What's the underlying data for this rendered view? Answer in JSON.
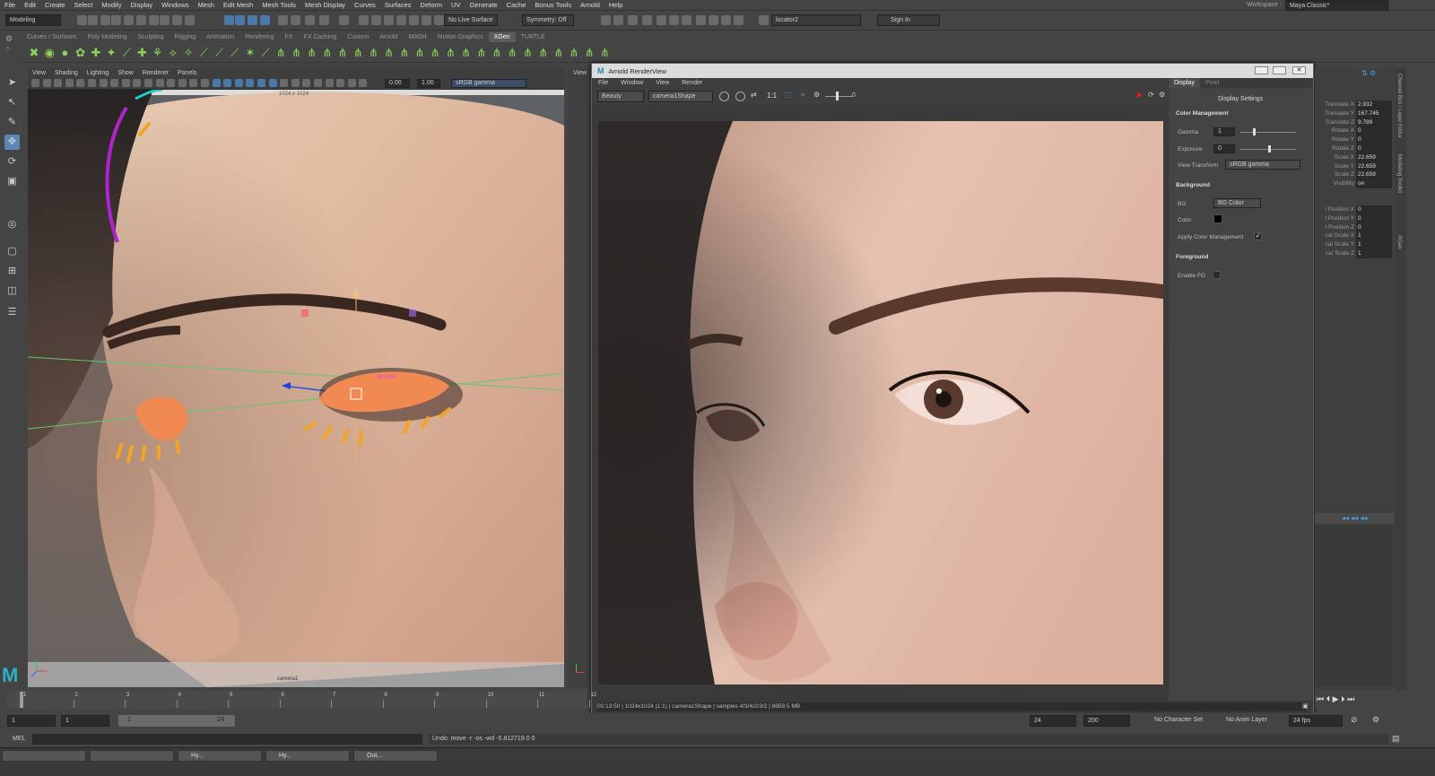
{
  "menubar": {
    "items": [
      "File",
      "Edit",
      "Create",
      "Select",
      "Modify",
      "Display",
      "Windows",
      "Mesh",
      "Edit Mesh",
      "Mesh Tools",
      "Mesh Display",
      "Curves",
      "Surfaces",
      "Deform",
      "UV",
      "Generate",
      "Cache",
      "Bonus Tools",
      "Arnold",
      "Help"
    ],
    "workspace_label": "Workspace :",
    "workspace_value": "Maya Classic*"
  },
  "toolbar": {
    "mode": "Modeling",
    "live_surface": "No Live Surface",
    "symmetry": "Symmetry: Off",
    "object_field": "locator2",
    "sign_in": "Sign In"
  },
  "shelf": {
    "tabs": [
      "Curves / Surfaces",
      "Poly Modeling",
      "Sculpting",
      "Rigging",
      "Animation",
      "Rendering",
      "FX",
      "FX Caching",
      "Custom",
      "Arnold",
      "MASH",
      "Motion Graphics",
      "XGen",
      "TURTLE"
    ],
    "active_tab": "XGen"
  },
  "viewport": {
    "menu": [
      "View",
      "Shading",
      "Lighting",
      "Show",
      "Renderer",
      "Panels"
    ],
    "exposure": "0.00",
    "gamma": "1.00",
    "color_transform": "sRGB gamma",
    "resolution_label": "1024 x 1024",
    "camera_label": "camera1",
    "manip_value": "45.0000"
  },
  "viewport2": {
    "menu_label": "View"
  },
  "renderview": {
    "title": "Arnold RenderView",
    "menu": [
      "File",
      "Window",
      "View",
      "Render"
    ],
    "aov": "Beauty",
    "camera": "camera1Shape",
    "ratio": "1:1",
    "slider_value": "0",
    "status": "00:13:50 | 1024x1024 (1:1) | camera1Shape | samples 4/3/4/2/3/2 | 8859.5 MB",
    "panel_tabs": [
      "Display",
      "Pixel"
    ],
    "display_settings": {
      "heading": "Display Settings",
      "color_management": "Color Management",
      "gamma_label": "Gamma",
      "gamma_value": "1",
      "exposure_label": "Exposure",
      "exposure_value": "0",
      "view_transform_label": "View Transform",
      "view_transform_value": "sRGB gamma",
      "background": "Background",
      "bg_label": "BG",
      "bg_value": "BG Color",
      "color_label": "Color",
      "apply_cm_label": "Apply Color Management",
      "foreground": "Foreground",
      "enable_fg_label": "Enable FG"
    }
  },
  "channel_box": {
    "rows": [
      {
        "name": "Translate X",
        "value": "2.932"
      },
      {
        "name": "Translate Y",
        "value": "167.745"
      },
      {
        "name": "Translate Z",
        "value": "9.789"
      },
      {
        "name": "Rotate X",
        "value": "0"
      },
      {
        "name": "Rotate Y",
        "value": "0"
      },
      {
        "name": "Rotate Z",
        "value": "0"
      },
      {
        "name": "Scale X",
        "value": "22.659"
      },
      {
        "name": "Scale Y",
        "value": "22.659"
      },
      {
        "name": "Scale Z",
        "value": "22.659"
      },
      {
        "name": "Visibility",
        "value": "on"
      }
    ],
    "shape_rows": [
      {
        "name": "l Position X",
        "value": "0"
      },
      {
        "name": "l Position Y",
        "value": "0"
      },
      {
        "name": "l Position Z",
        "value": "0"
      },
      {
        "name": "cal Scale X",
        "value": "1"
      },
      {
        "name": "cal Scale Y",
        "value": "1"
      },
      {
        "name": "cal Scale Z",
        "value": "1"
      }
    ],
    "side_tabs": [
      "Channel Box / Layer Editor",
      "Modeling Toolkit",
      "XGen"
    ]
  },
  "timeline": {
    "ticks": [
      "1",
      "2",
      "3",
      "4",
      "5",
      "6",
      "7",
      "8",
      "9",
      "10",
      "11",
      "12"
    ],
    "current": "1"
  },
  "range": {
    "start": "1",
    "start2": "1",
    "range_start": "1",
    "range_end": "24",
    "end": "24",
    "end2": "200",
    "char_set": "No Character Set",
    "anim_layer": "No Anim Layer",
    "fps": "24 fps"
  },
  "cmdline": {
    "label": "MEL",
    "feedback": "Undo: move -r -os -wd -5.812719 0 0"
  },
  "taskbar": {
    "items": [
      "",
      "",
      "Hy...",
      "Hy...",
      "Out..."
    ]
  }
}
